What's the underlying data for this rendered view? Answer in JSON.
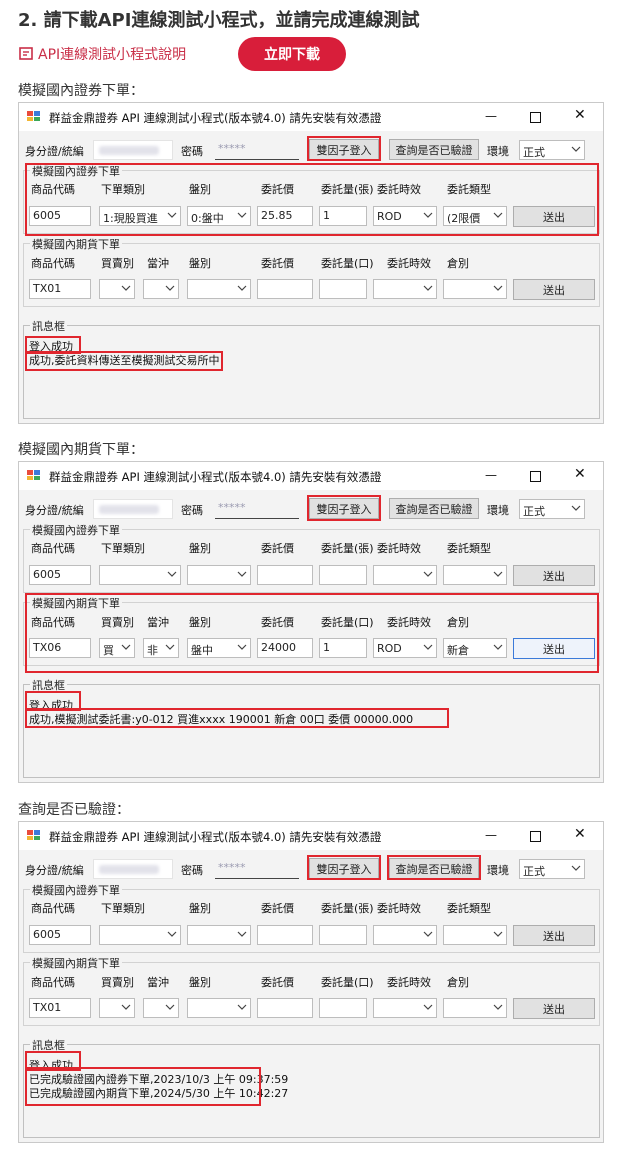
{
  "heading": "2. 請下載API連線測試小程式，並請完成連線測試",
  "doc_link_label": "API連線測試小程式說明",
  "download_label": "立即下載",
  "sections": [
    {
      "label": "模擬國內證券下單："
    },
    {
      "label": "模擬國內期貨下單："
    },
    {
      "label": "查詢是否已驗證："
    }
  ],
  "window": {
    "title": "群益金鼎證券 API 連線測試小程式(版本號4.0) 請先安裝有效憑證",
    "id_label": "身分證/統編",
    "pwd_label": "密碼",
    "pwd_value": "*****",
    "login_btn": "雙因子登入",
    "verify_btn": "查詢是否已驗證",
    "env_label": "環境",
    "env_value": "正式",
    "stock_group": "模擬國內證券下單",
    "futures_group": "模擬國內期貨下單",
    "msg_group": "訊息框",
    "submit": "送出",
    "stock_headers": [
      "商品代碼",
      "下單類別",
      "盤別",
      "委託價",
      "委託量(張)",
      "委託時效",
      "委託類型"
    ],
    "futures_headers": [
      "商品代碼",
      "買賣別",
      "當沖",
      "盤別",
      "委託價",
      "委託量(口)",
      "委託時效",
      "倉別"
    ]
  },
  "windows": [
    {
      "stock": {
        "code": "6005",
        "type": "1:現股買進",
        "session": "0:盤中",
        "price": "25.85",
        "qty": "1",
        "tif": "ROD",
        "kind": "(2限價"
      },
      "futures": {
        "code": "TX01",
        "side": "",
        "daytrade": "",
        "session": "",
        "price": "",
        "qty": "",
        "tif": "",
        "position": ""
      },
      "messages": [
        "登入成功",
        "成功,委託資料傳送至模擬測試交易所中!"
      ]
    },
    {
      "stock": {
        "code": "6005",
        "type": "",
        "session": "",
        "price": "",
        "qty": "",
        "tif": "",
        "kind": ""
      },
      "futures": {
        "code": "TX06",
        "side": "買",
        "daytrade": "非",
        "session": "盤中",
        "price": "24000",
        "qty": "1",
        "tif": "ROD",
        "position": "新倉"
      },
      "messages": [
        "登入成功",
        "成功,模擬測試委託書:y0-012 買進xxxx   190001     新倉  00口    委價 00000.000"
      ]
    },
    {
      "stock": {
        "code": "6005",
        "type": "",
        "session": "",
        "price": "",
        "qty": "",
        "tif": "",
        "kind": ""
      },
      "futures": {
        "code": "TX01",
        "side": "",
        "daytrade": "",
        "session": "",
        "price": "",
        "qty": "",
        "tif": "",
        "position": ""
      },
      "messages": [
        "登入成功",
        "已完成驗證國內證券下單,2023/10/3 上午 09:37:59",
        "已完成驗證國內期貨下單,2024/5/30 上午 10:42:27"
      ]
    }
  ]
}
